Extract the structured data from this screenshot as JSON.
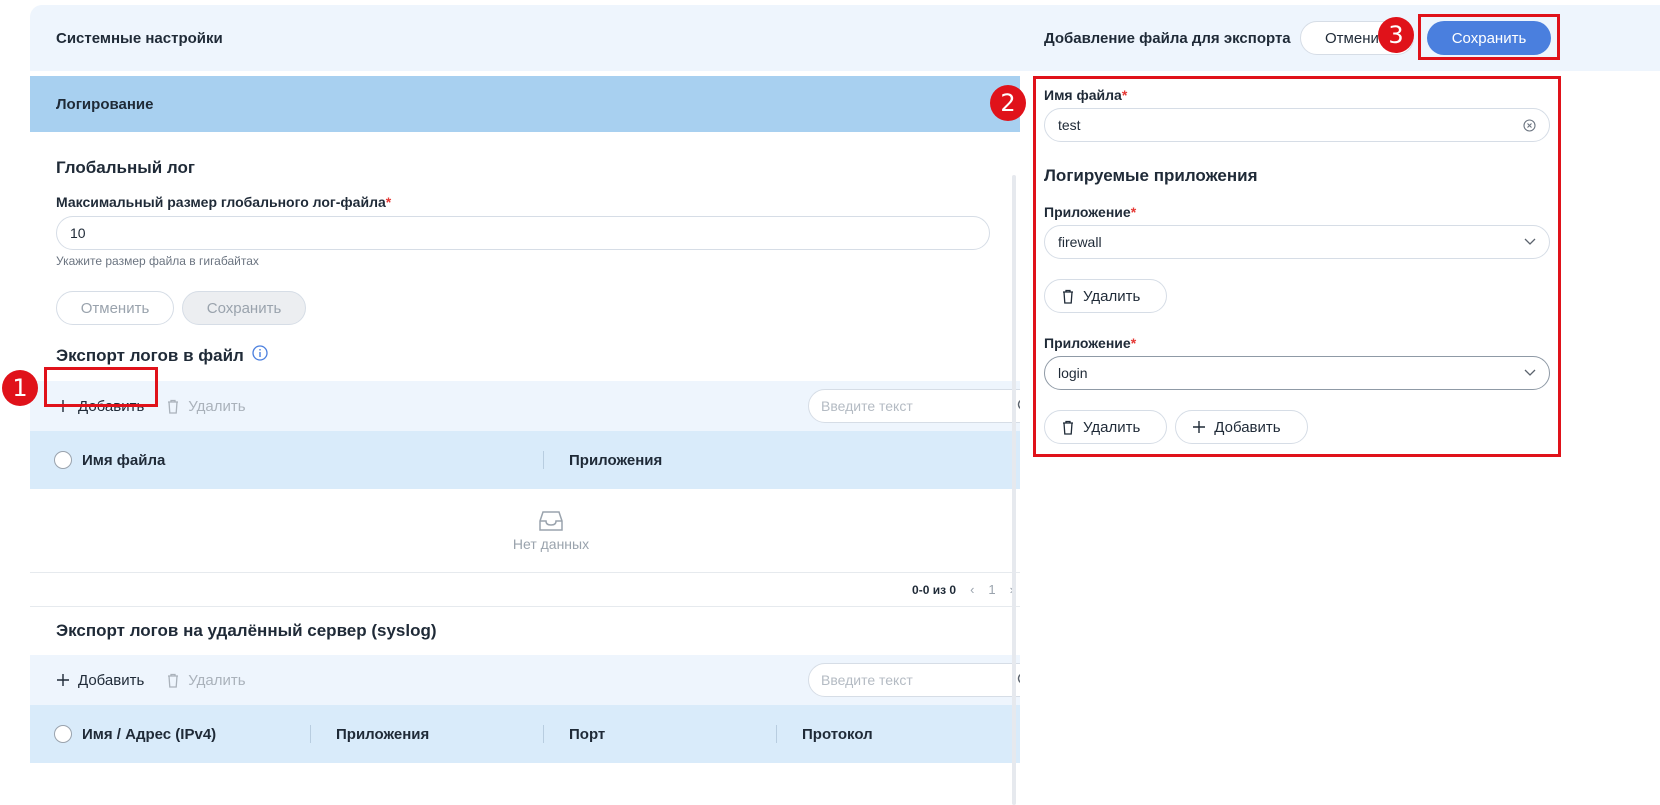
{
  "left_header": {
    "title": "Системные настройки"
  },
  "accordion": {
    "title": "Логирование"
  },
  "global_log": {
    "title": "Глобальный лог",
    "size_label": "Максимальный размер глобального лог-файла",
    "size_value": "10",
    "hint": "Укажите размер файла в гигабайтах",
    "cancel_label": "Отменить",
    "save_label": "Сохранить"
  },
  "file_export": {
    "title": "Экспорт логов в файл",
    "add_label": "Добавить",
    "delete_label": "Удалить",
    "search_placeholder": "Введите текст",
    "columns": [
      "Имя файла",
      "Приложения"
    ],
    "empty_text": "Нет данных",
    "pager": {
      "range": "0-0 из 0",
      "page": "1"
    }
  },
  "syslog_export": {
    "title": "Экспорт логов на удалённый сервер (syslog)",
    "add_label": "Добавить",
    "delete_label": "Удалить",
    "search_placeholder": "Введите текст",
    "columns": [
      "Имя / Адрес (IPv4)",
      "Приложения",
      "Порт",
      "Протокол"
    ]
  },
  "right_panel": {
    "title": "Добавление файла для экспорта",
    "cancel_label": "Отмени",
    "save_label": "Сохранить",
    "file_name_label": "Имя файла",
    "file_name_value": "test",
    "apps_title": "Логируемые приложения",
    "app_label": "Приложение",
    "apps": [
      {
        "value": "firewall",
        "delete_label": "Удалить"
      },
      {
        "value": "login",
        "delete_label": "Удалить",
        "add_label": "Добавить"
      }
    ]
  },
  "annotations": [
    "1",
    "2",
    "3"
  ],
  "colors": {
    "accent": "#4a7fde",
    "highlight": "#e0121a",
    "accordion": "#a8d0f0"
  }
}
